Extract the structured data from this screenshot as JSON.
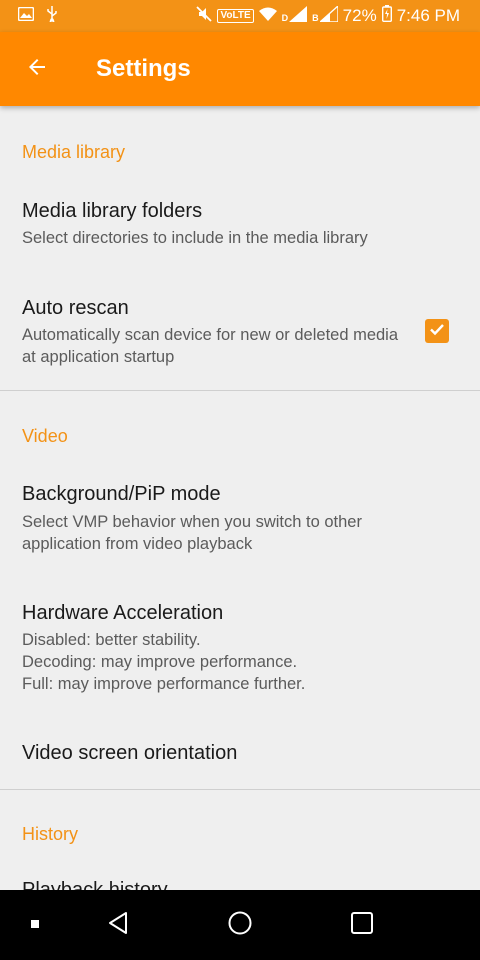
{
  "status_bar": {
    "volte": "VoLTE",
    "sim1_label": "D",
    "sim2_label": "B",
    "battery_percent": "72%",
    "time": "7:46 PM",
    "icons": [
      "gallery-icon",
      "usb-icon",
      "mute-icon",
      "wifi-icon",
      "signal-icon",
      "battery-icon"
    ]
  },
  "app_bar": {
    "title": "Settings"
  },
  "sections": [
    {
      "header": "Media library",
      "items": [
        {
          "title": "Media library folders",
          "summary": "Select directories to include in the media library"
        },
        {
          "title": "Auto rescan",
          "summary": "Automatically scan device for new or deleted media at application startup",
          "checked": true
        }
      ]
    },
    {
      "header": "Video",
      "items": [
        {
          "title": "Background/PiP mode",
          "summary": "Select VMP behavior when you switch to other application from video playback"
        },
        {
          "title": "Hardware Acceleration",
          "summary_lines": [
            "Disabled: better stability.",
            "Decoding: may improve performance.",
            "Full: may improve performance further."
          ]
        },
        {
          "title": "Video screen orientation"
        }
      ]
    },
    {
      "header": "History",
      "items": [
        {
          "title": "Playback history"
        }
      ]
    }
  ],
  "colors": {
    "status_bar": "#f39216",
    "app_bar": "#ff8800",
    "accent": "#f39216",
    "background": "#efefef"
  },
  "nav_bar": {
    "icons": [
      "recents-dot-icon",
      "back-triangle-icon",
      "home-circle-icon",
      "overview-square-icon"
    ]
  }
}
